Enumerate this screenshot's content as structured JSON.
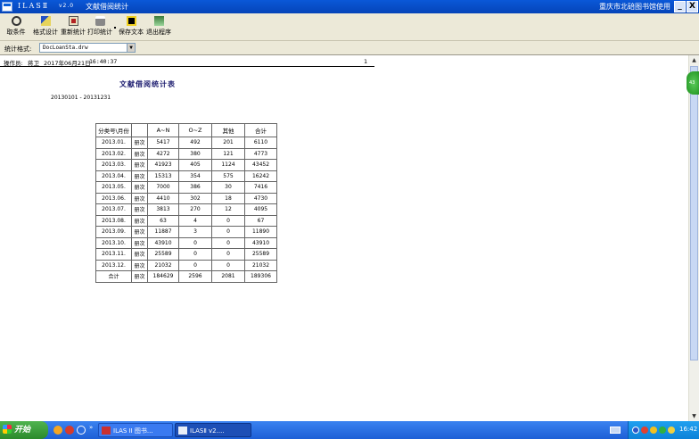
{
  "window": {
    "title_name": "ILASⅡ",
    "title_version": "v2.0",
    "title_module": "文献借阅统计",
    "title_library": "重庆市北碚图书馆使用",
    "min_label": "_",
    "close_label": "X"
  },
  "toolbar": {
    "items": [
      {
        "label": "取条件",
        "icon": "binoculars-icon"
      },
      {
        "label": "格式设计",
        "icon": "design-icon"
      },
      {
        "label": "重新统计",
        "icon": "refresh-icon"
      },
      {
        "label": "打印统计",
        "icon": "printer-icon"
      },
      {
        "label": "保存文本",
        "icon": "save-icon"
      },
      {
        "label": "退出程序",
        "icon": "exit-icon"
      }
    ]
  },
  "format": {
    "label": "统计格式:",
    "value": "DocLoanSta.drw"
  },
  "operator": {
    "label": "操作员:",
    "name": "蒋卫",
    "date": "2017年06月21日",
    "time": "16:40:37",
    "page": "1"
  },
  "report": {
    "title": "文献借阅统计表",
    "range": "20130101 - 20131231",
    "headers": [
      "分类号\\月份",
      "",
      "A~N",
      "O~Z",
      "其他",
      "合计"
    ],
    "rows": [
      [
        "2013.01.",
        "册次",
        "5417",
        "492",
        "201",
        "6110"
      ],
      [
        "2013.02.",
        "册次",
        "4272",
        "380",
        "121",
        "4773"
      ],
      [
        "2013.03.",
        "册次",
        "41923",
        "405",
        "1124",
        "43452"
      ],
      [
        "2013.04.",
        "册次",
        "15313",
        "354",
        "575",
        "16242"
      ],
      [
        "2013.05.",
        "册次",
        "7000",
        "386",
        "30",
        "7416"
      ],
      [
        "2013.06.",
        "册次",
        "4410",
        "302",
        "18",
        "4730"
      ],
      [
        "2013.07.",
        "册次",
        "3813",
        "270",
        "12",
        "4095"
      ],
      [
        "2013.08.",
        "册次",
        "63",
        "4",
        "0",
        "67"
      ],
      [
        "2013.09.",
        "册次",
        "11887",
        "3",
        "0",
        "11890"
      ],
      [
        "2013.10.",
        "册次",
        "43910",
        "0",
        "0",
        "43910"
      ],
      [
        "2013.11.",
        "册次",
        "25589",
        "0",
        "0",
        "25589"
      ],
      [
        "2013.12.",
        "册次",
        "21032",
        "0",
        "0",
        "21032"
      ],
      [
        "合计",
        "册次",
        "184629",
        "2596",
        "2081",
        "189306"
      ]
    ]
  },
  "side_bubble": "43",
  "taskbar": {
    "start_label": "开始",
    "more_label": "»",
    "tasks": [
      "ILAS II 图书...",
      "ILASⅡ v2...."
    ],
    "clock": "16:42"
  },
  "colors": {
    "titlebar": "#0a58d8",
    "toolbar_bg": "#ece9d8",
    "taskbar": "#2a6fe8",
    "start_button": "#3a9a3a"
  }
}
